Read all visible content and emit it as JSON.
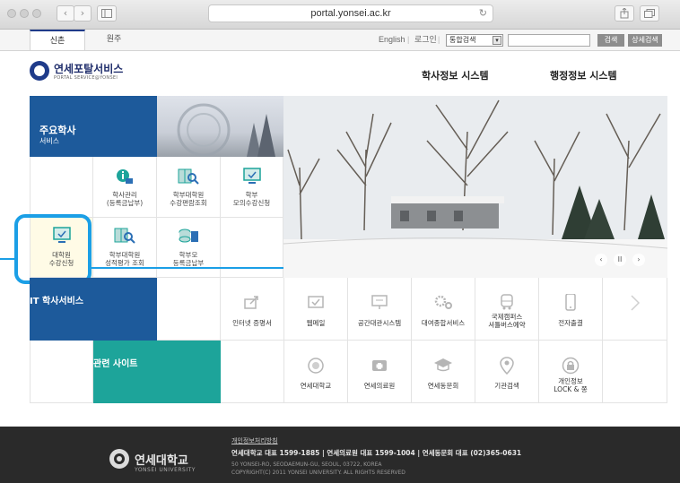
{
  "browser": {
    "url": "portal.yonsei.ac.kr",
    "back": "‹",
    "forward": "›",
    "reload": "↻"
  },
  "topbar": {
    "tabs": [
      "신촌",
      "원주"
    ],
    "links": [
      "English",
      "|",
      "로그인",
      "|"
    ],
    "select_value": "통합검색",
    "search_button": "검색",
    "advanced_button": "상세검색"
  },
  "header": {
    "logo_title": "연세포탈서비스",
    "logo_sub": "PORTAL SERVICE@YONSEI",
    "nav": [
      "학사정보 시스템",
      "행정정보 시스템"
    ]
  },
  "academic": {
    "title": "주요학사",
    "subtitle": "서비스",
    "tiles": [
      {
        "label": "학사관리\n(등록금납부)",
        "icon": "info-icon"
      },
      {
        "label": "학부대학원\n수강편람조회",
        "icon": "book-search-icon"
      },
      {
        "label": "학부\n모의수강신청",
        "icon": "monitor-icon"
      },
      {
        "label": "대학원\n수강신청",
        "icon": "monitor-icon"
      },
      {
        "label": "학부대학원\n성적평가 조회",
        "icon": "book-search-icon"
      },
      {
        "label": "학부모\n등록금납부",
        "icon": "coins-icon"
      }
    ]
  },
  "it_services": {
    "title": "IT 학사서비스",
    "items": [
      "인터넷 증명서",
      "웹메일",
      "공간대관시스템",
      "대여종합서비스",
      "국제캠퍼스\n셔틀버스예약",
      "전자출결"
    ]
  },
  "related": {
    "title": "관련 사이트",
    "items": [
      "연세대학교",
      "연세의료원",
      "연세동문회",
      "기관검색",
      "개인정보\nLOCK & 쫑"
    ]
  },
  "carousel": {
    "prev": "‹",
    "pause": "II",
    "next": "›"
  },
  "footer": {
    "logo_title": "연세대학교",
    "logo_sub": "YONSEI UNIVERSITY",
    "privacy": "개인정보처리방침",
    "phones": "연세대학교 대표 1599-1885  |  연세의료원 대표 1599-1004  |  연세동문회 대표 (02)365-0631",
    "address": "50 YONSEI-RO, SEODAEMUN-GU, SEOUL, 03722, KOREA",
    "copyright": "COPYRIGHT(C) 2011 YONSEI UNIVERSITY. ALL RIGHTS RESERVED"
  },
  "colors": {
    "navy": "#1f3b8a",
    "blue": "#1d5a9b",
    "teal": "#1da49a",
    "highlight": "#1b9fe6",
    "footer": "#2a2a2a"
  }
}
